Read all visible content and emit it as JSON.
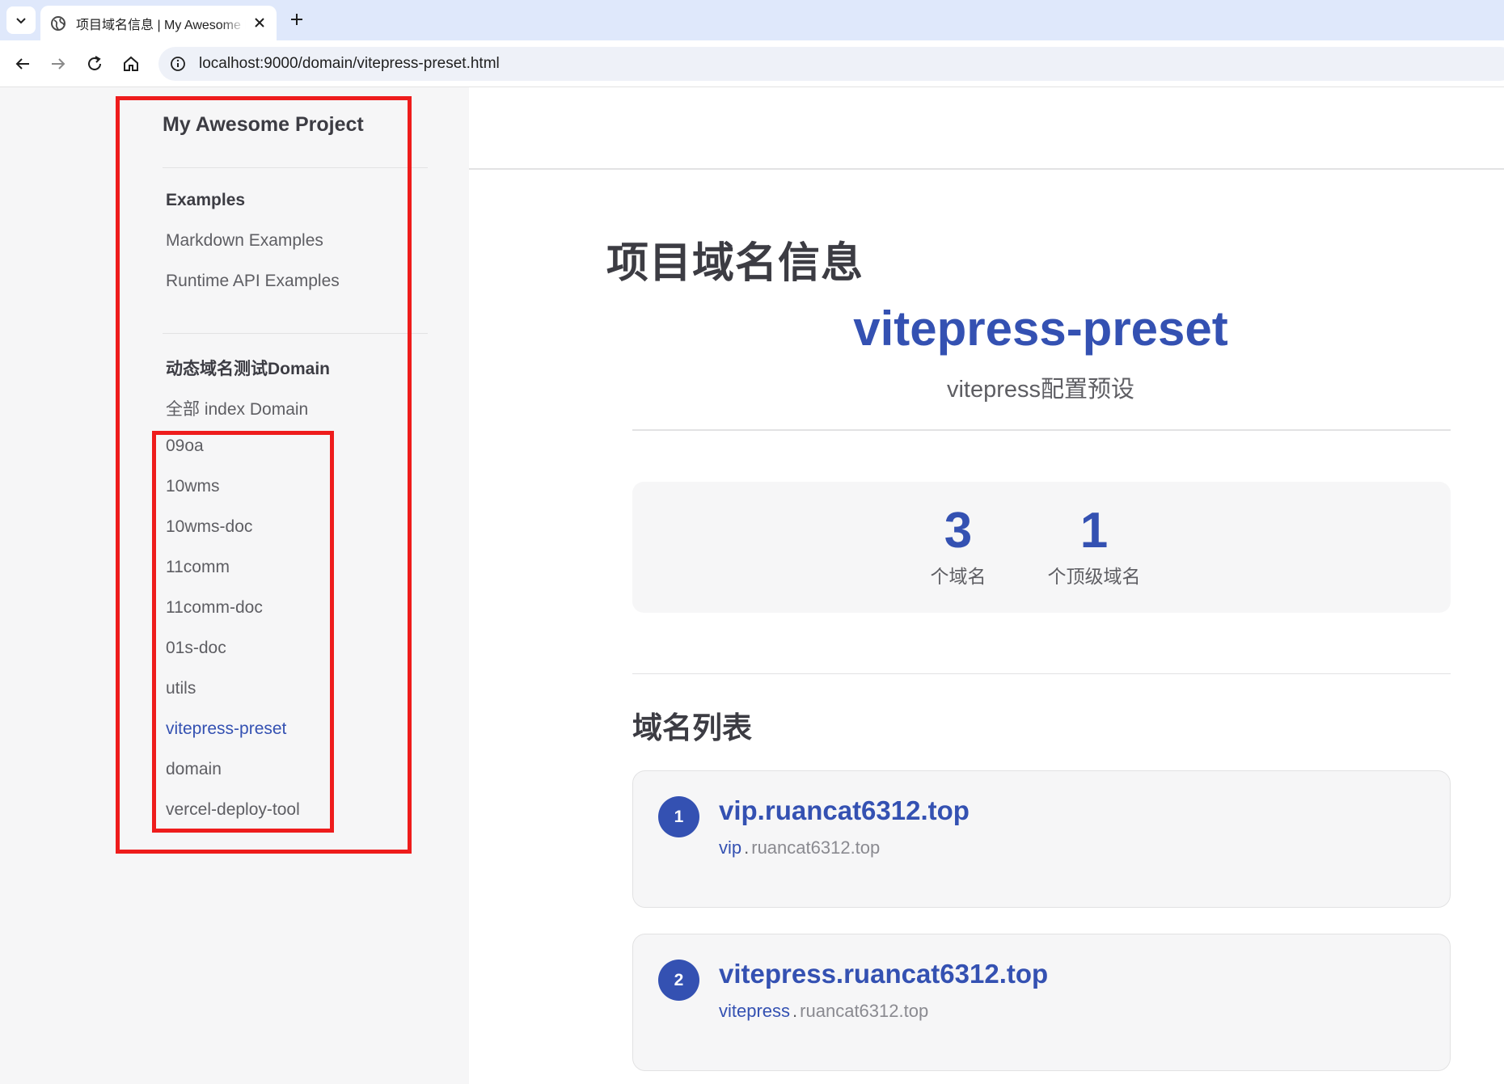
{
  "browser": {
    "tab_title": "项目域名信息 | My Awesome Project",
    "url": "localhost:9000/domain/vitepress-preset.html"
  },
  "sidebar": {
    "project_title": "My Awesome Project",
    "groups": [
      {
        "title": "Examples",
        "items": [
          {
            "label": "Markdown Examples"
          },
          {
            "label": "Runtime API Examples"
          }
        ]
      },
      {
        "title": "动态域名测试Domain",
        "items": [
          {
            "label": "全部 index Domain"
          },
          {
            "label": "09oa"
          },
          {
            "label": "10wms"
          },
          {
            "label": "10wms-doc"
          },
          {
            "label": "11comm"
          },
          {
            "label": "11comm-doc"
          },
          {
            "label": "01s-doc"
          },
          {
            "label": "utils"
          },
          {
            "label": "vitepress-preset",
            "active": true
          },
          {
            "label": "domain"
          },
          {
            "label": "vercel-deploy-tool"
          }
        ]
      }
    ]
  },
  "main": {
    "heading": "项目域名信息",
    "project_name": "vitepress-preset",
    "project_desc": "vitepress配置预设",
    "stats": [
      {
        "value": "3",
        "label": "个域名"
      },
      {
        "value": "1",
        "label": "个顶级域名"
      }
    ],
    "list_heading": "域名列表",
    "domains": [
      {
        "index": "1",
        "full": "vip.ruancat6312.top",
        "sub": "vip",
        "dot": ".",
        "root": "ruancat6312.top"
      },
      {
        "index": "2",
        "full": "vitepress.ruancat6312.top",
        "sub": "vitepress",
        "dot": ".",
        "root": "ruancat6312.top"
      }
    ]
  },
  "colors": {
    "brand": "#3451b2",
    "highlight_box": "#ee1c1c",
    "sidebar_bg": "#f6f6f7"
  }
}
